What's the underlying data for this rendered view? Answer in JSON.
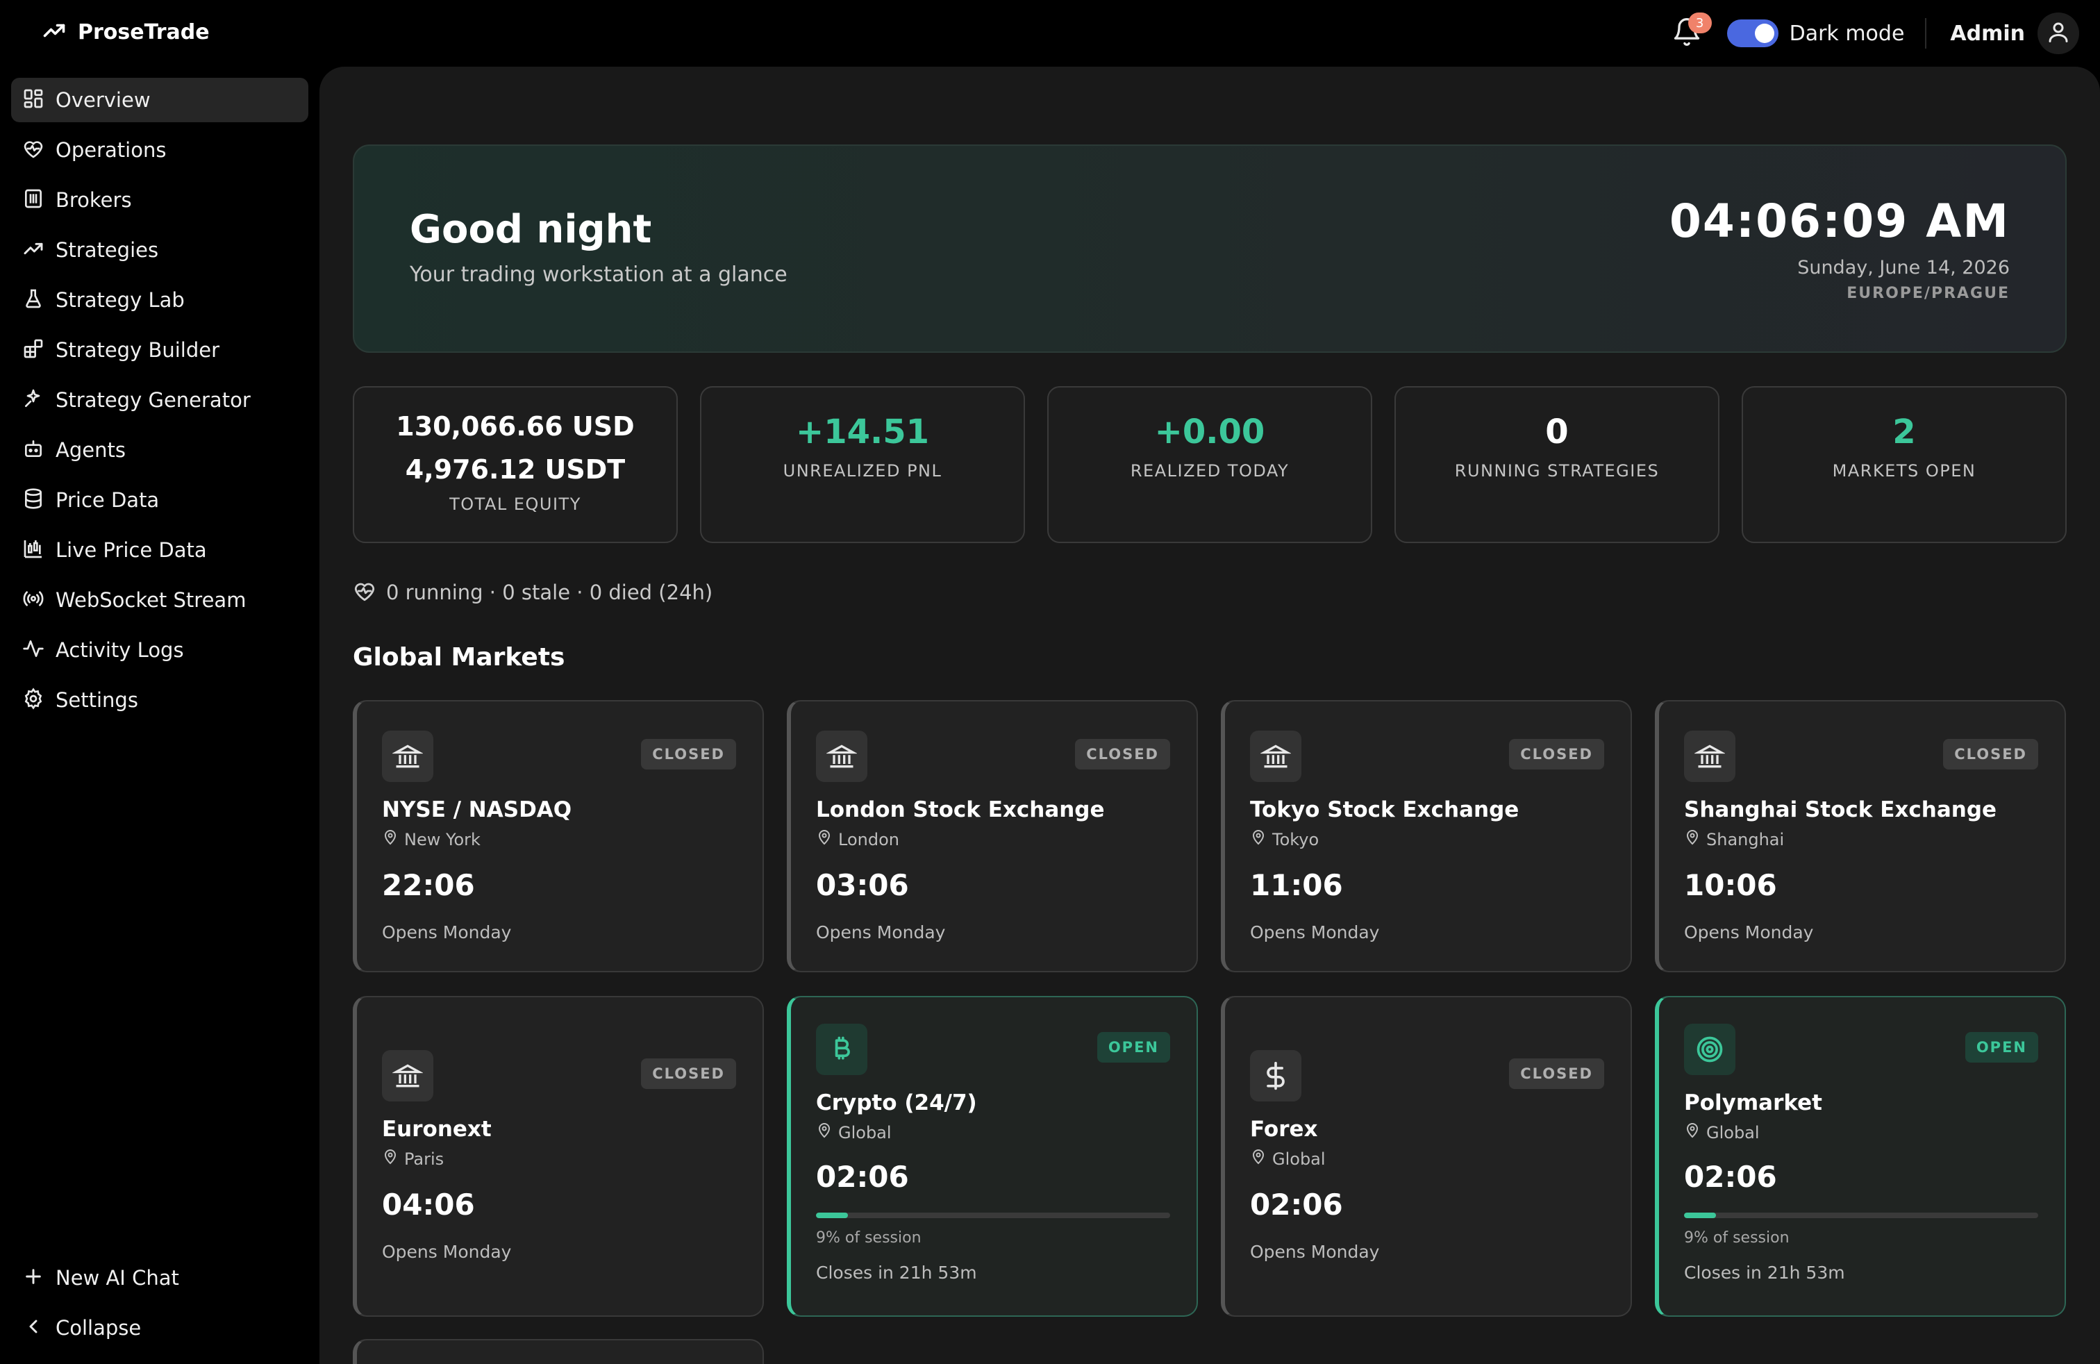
{
  "app": {
    "brand": "ProseTrade"
  },
  "topbar": {
    "notifications_count": "3",
    "dark_mode_label": "Dark mode",
    "dark_mode_on": true,
    "user_name": "Admin"
  },
  "sidebar": {
    "items": [
      {
        "label": "Overview",
        "icon": "grid-icon",
        "active": true
      },
      {
        "label": "Operations",
        "icon": "heart-pulse-icon"
      },
      {
        "label": "Brokers",
        "icon": "building-icon"
      },
      {
        "label": "Strategies",
        "icon": "trending-up-icon"
      },
      {
        "label": "Strategy Lab",
        "icon": "flask-icon"
      },
      {
        "label": "Strategy Builder",
        "icon": "blocks-icon"
      },
      {
        "label": "Strategy Generator",
        "icon": "sparkle-wand-icon"
      },
      {
        "label": "Agents",
        "icon": "bot-icon"
      },
      {
        "label": "Price Data",
        "icon": "database-icon"
      },
      {
        "label": "Live Price Data",
        "icon": "candlestick-icon"
      },
      {
        "label": "WebSocket Stream",
        "icon": "radio-icon"
      },
      {
        "label": "Activity Logs",
        "icon": "activity-icon"
      },
      {
        "label": "Settings",
        "icon": "gear-icon"
      }
    ],
    "new_chat_label": "New AI Chat",
    "collapse_label": "Collapse"
  },
  "hero": {
    "greeting": "Good night",
    "subtitle": "Your trading workstation at a glance",
    "time": "04:06:09 AM",
    "date": "Sunday, June 14, 2026",
    "timezone": "EUROPE/PRAGUE"
  },
  "stats": {
    "equity_usd": "130,066.66 USD",
    "equity_usdt": "4,976.12 USDT",
    "equity_caption": "TOTAL EQUITY",
    "unrealized_value": "+14.51",
    "unrealized_caption": "UNREALIZED PNL",
    "realized_value": "+0.00",
    "realized_caption": "REALIZED TODAY",
    "running_value": "0",
    "running_caption": "RUNNING STRATEGIES",
    "markets_value": "2",
    "markets_caption": "MARKETS OPEN"
  },
  "health": {
    "text": "0 running · 0 stale · 0 died (24h)"
  },
  "markets": {
    "title": "Global Markets",
    "cards": [
      {
        "name": "NYSE / NASDAQ",
        "location": "New York",
        "time": "22:06",
        "badge": "CLOSED",
        "status": "Opens Monday",
        "icon": "bank-icon"
      },
      {
        "name": "London Stock Exchange",
        "location": "London",
        "time": "03:06",
        "badge": "CLOSED",
        "status": "Opens Monday",
        "icon": "bank-icon"
      },
      {
        "name": "Tokyo Stock Exchange",
        "location": "Tokyo",
        "time": "11:06",
        "badge": "CLOSED",
        "status": "Opens Monday",
        "icon": "bank-icon"
      },
      {
        "name": "Shanghai Stock Exchange",
        "location": "Shanghai",
        "time": "10:06",
        "badge": "CLOSED",
        "status": "Opens Monday",
        "icon": "bank-icon"
      },
      {
        "name": "Euronext",
        "location": "Paris",
        "time": "04:06",
        "badge": "CLOSED",
        "status": "Opens Monday",
        "icon": "bank-icon"
      },
      {
        "name": "Crypto (24/7)",
        "location": "Global",
        "time": "02:06",
        "badge": "OPEN",
        "status": "Closes in 21h 53m",
        "session_text": "9% of session",
        "session_progress": 0.09,
        "icon": "bitcoin-icon"
      },
      {
        "name": "Forex",
        "location": "Global",
        "time": "02:06",
        "badge": "CLOSED",
        "status": "Opens Monday",
        "icon": "dollar-icon"
      },
      {
        "name": "Polymarket",
        "location": "Global",
        "time": "02:06",
        "badge": "OPEN",
        "status": "Closes in 21h 53m",
        "session_text": "9% of session",
        "session_progress": 0.09,
        "icon": "target-icon"
      }
    ]
  },
  "colors": {
    "accent_green": "#3cc79a",
    "toggle_blue": "#4a68e0",
    "badge_red": "#f0826a"
  }
}
